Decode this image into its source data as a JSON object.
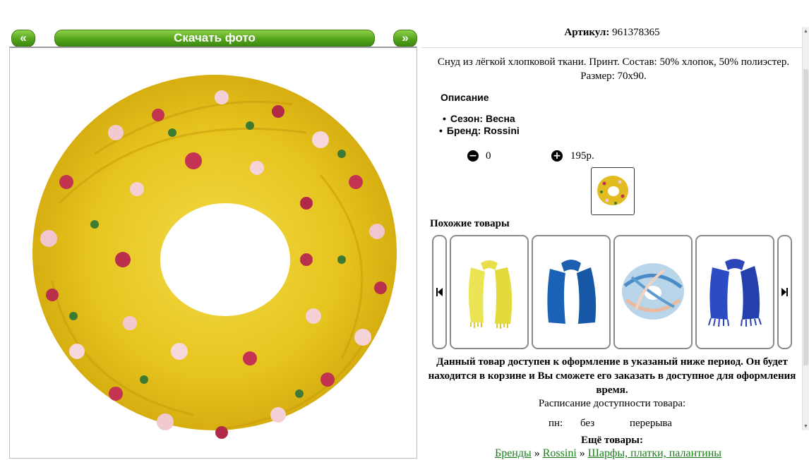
{
  "gallery": {
    "prev_label": "«",
    "next_label": "»",
    "download_label": "Скачать фото"
  },
  "product": {
    "article_label": "Артикул:",
    "article_value": "961378365",
    "description": "Снуд из лёгкой хлопковой ткани. Принт. Состав: 50% хлопок, 50% полиэстер. Размер: 70х90.",
    "section_title": "Описание",
    "properties": [
      "Сезон: Весна",
      "Бренд: Rossini"
    ],
    "quantity": "0",
    "price": "195р."
  },
  "similar": {
    "title": "Похожие товары",
    "items": [
      {
        "image": "yellow-scarf"
      },
      {
        "image": "blue-scarf"
      },
      {
        "image": "blue-white-snood"
      },
      {
        "image": "blue-fringe-scarf"
      }
    ]
  },
  "availability": {
    "notice": "Данный товар доступен к оформление в указаный ниже период. Он будет находится в корзине и Вы сможете его заказать в доступное для оформления время.",
    "schedule_title": "Расписание доступности товара:",
    "schedule_day": "пн:",
    "schedule_from": "без",
    "schedule_to": "перерыва"
  },
  "more": {
    "title": "Ещё товары:",
    "breadcrumbs": [
      "Бренды",
      "Rossini",
      "Шарфы, платки, палантины"
    ],
    "separator": "»"
  },
  "colors": {
    "accent_green": "#55a51c",
    "link_green": "#1a7d1a",
    "scarf_yellow": "#e9c928"
  }
}
